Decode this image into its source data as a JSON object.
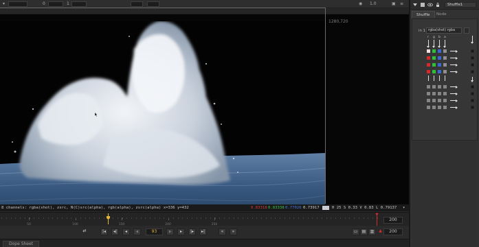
{
  "top_bar": {
    "zoom_value": "1.0",
    "field_a": "0",
    "field_b": "1"
  },
  "viewer": {
    "format_label": "1280,720"
  },
  "info_bar": {
    "path_text": "8 channels: rgba(shot), zsrc, N(C)src(alpha), rgb(alpha), zsrc(alpha) x=336 y=432",
    "r_value": "0.83318",
    "g_value": "0.83338",
    "b_value": "0.77026",
    "a_value": "0.73917",
    "hsv_text": "H 25 S 0.33 V 0.83  L 0.79137"
  },
  "timeline": {
    "ticks": [
      "50",
      "100",
      "150",
      "200",
      "250"
    ],
    "end_frame": "200"
  },
  "transport": {
    "current_frame": "93",
    "increment": "200"
  },
  "bottom": {
    "tab_label": "Dope Sheet"
  },
  "panel": {
    "node_name": "Shuffle1",
    "tabs": [
      "Shuffle",
      "Node"
    ],
    "in_label": "in 1",
    "in_select_value": "rgba(shot) rgba",
    "channel_labels": [
      "r",
      "g",
      "b",
      "a"
    ]
  },
  "colors": {
    "accent": "#e5b63a",
    "red": "#d32b2b",
    "green": "#2fbf3a",
    "blue": "#3a66d6"
  },
  "icons": [
    "eye-icon",
    "lock-icon",
    "play-icon",
    "node-icon"
  ]
}
